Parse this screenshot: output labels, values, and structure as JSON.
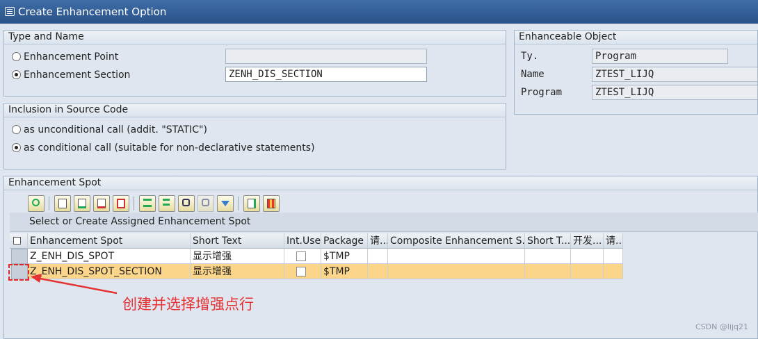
{
  "window": {
    "title": "Create Enhancement Option"
  },
  "type_and_name": {
    "title": "Type and Name",
    "options": [
      {
        "label": "Enhancement Point",
        "selected": false
      },
      {
        "label": "Enhancement Section",
        "selected": true
      }
    ],
    "point_value": "",
    "section_value": "ZENH_DIS_SECTION"
  },
  "enhanceable_object": {
    "title": "Enhanceable Object",
    "fields": [
      {
        "label": "Ty.",
        "value": "Program"
      },
      {
        "label": "Name",
        "value": "ZTEST_LIJQ"
      },
      {
        "label": "Program",
        "value": "ZTEST_LIJQ"
      }
    ]
  },
  "inclusion": {
    "title": "Inclusion in Source Code",
    "options": [
      {
        "label": "as unconditional call (addit. \"STATIC\")",
        "selected": false
      },
      {
        "label": "as conditional call (suitable for non-declarative statements)",
        "selected": true
      }
    ]
  },
  "enhancement_spot": {
    "title": "Enhancement Spot",
    "toolbar_icons": [
      "details-icon",
      "create-icon",
      "insert-row-icon",
      "delete-row-icon",
      "copy-icon",
      "sort-ascending-icon",
      "filter-icon",
      "find-icon",
      "find-next-icon",
      "set-filter-icon",
      "export-icon",
      "layout-icon"
    ],
    "grid_title": "Select or Create Assigned Enhancement Spot",
    "columns": [
      "Enhancement Spot",
      "Short Text",
      "Int.Use",
      "Package",
      "请...",
      "Composite Enhancement S...",
      "Short T...",
      "开发...",
      "请..."
    ],
    "rows": [
      {
        "spot": "Z_ENH_DIS_SPOT",
        "short_text": "显示增强",
        "int_use": false,
        "package": "$TMP",
        "selected": false
      },
      {
        "spot": "Z_ENH_DIS_SPOT_SECTION",
        "short_text": "显示增强",
        "int_use": false,
        "package": "$TMP",
        "selected": true
      }
    ]
  },
  "annotation": {
    "text": "创建并选择增强点行",
    "color": "#e53232"
  },
  "watermark": "CSDN @lijq21"
}
